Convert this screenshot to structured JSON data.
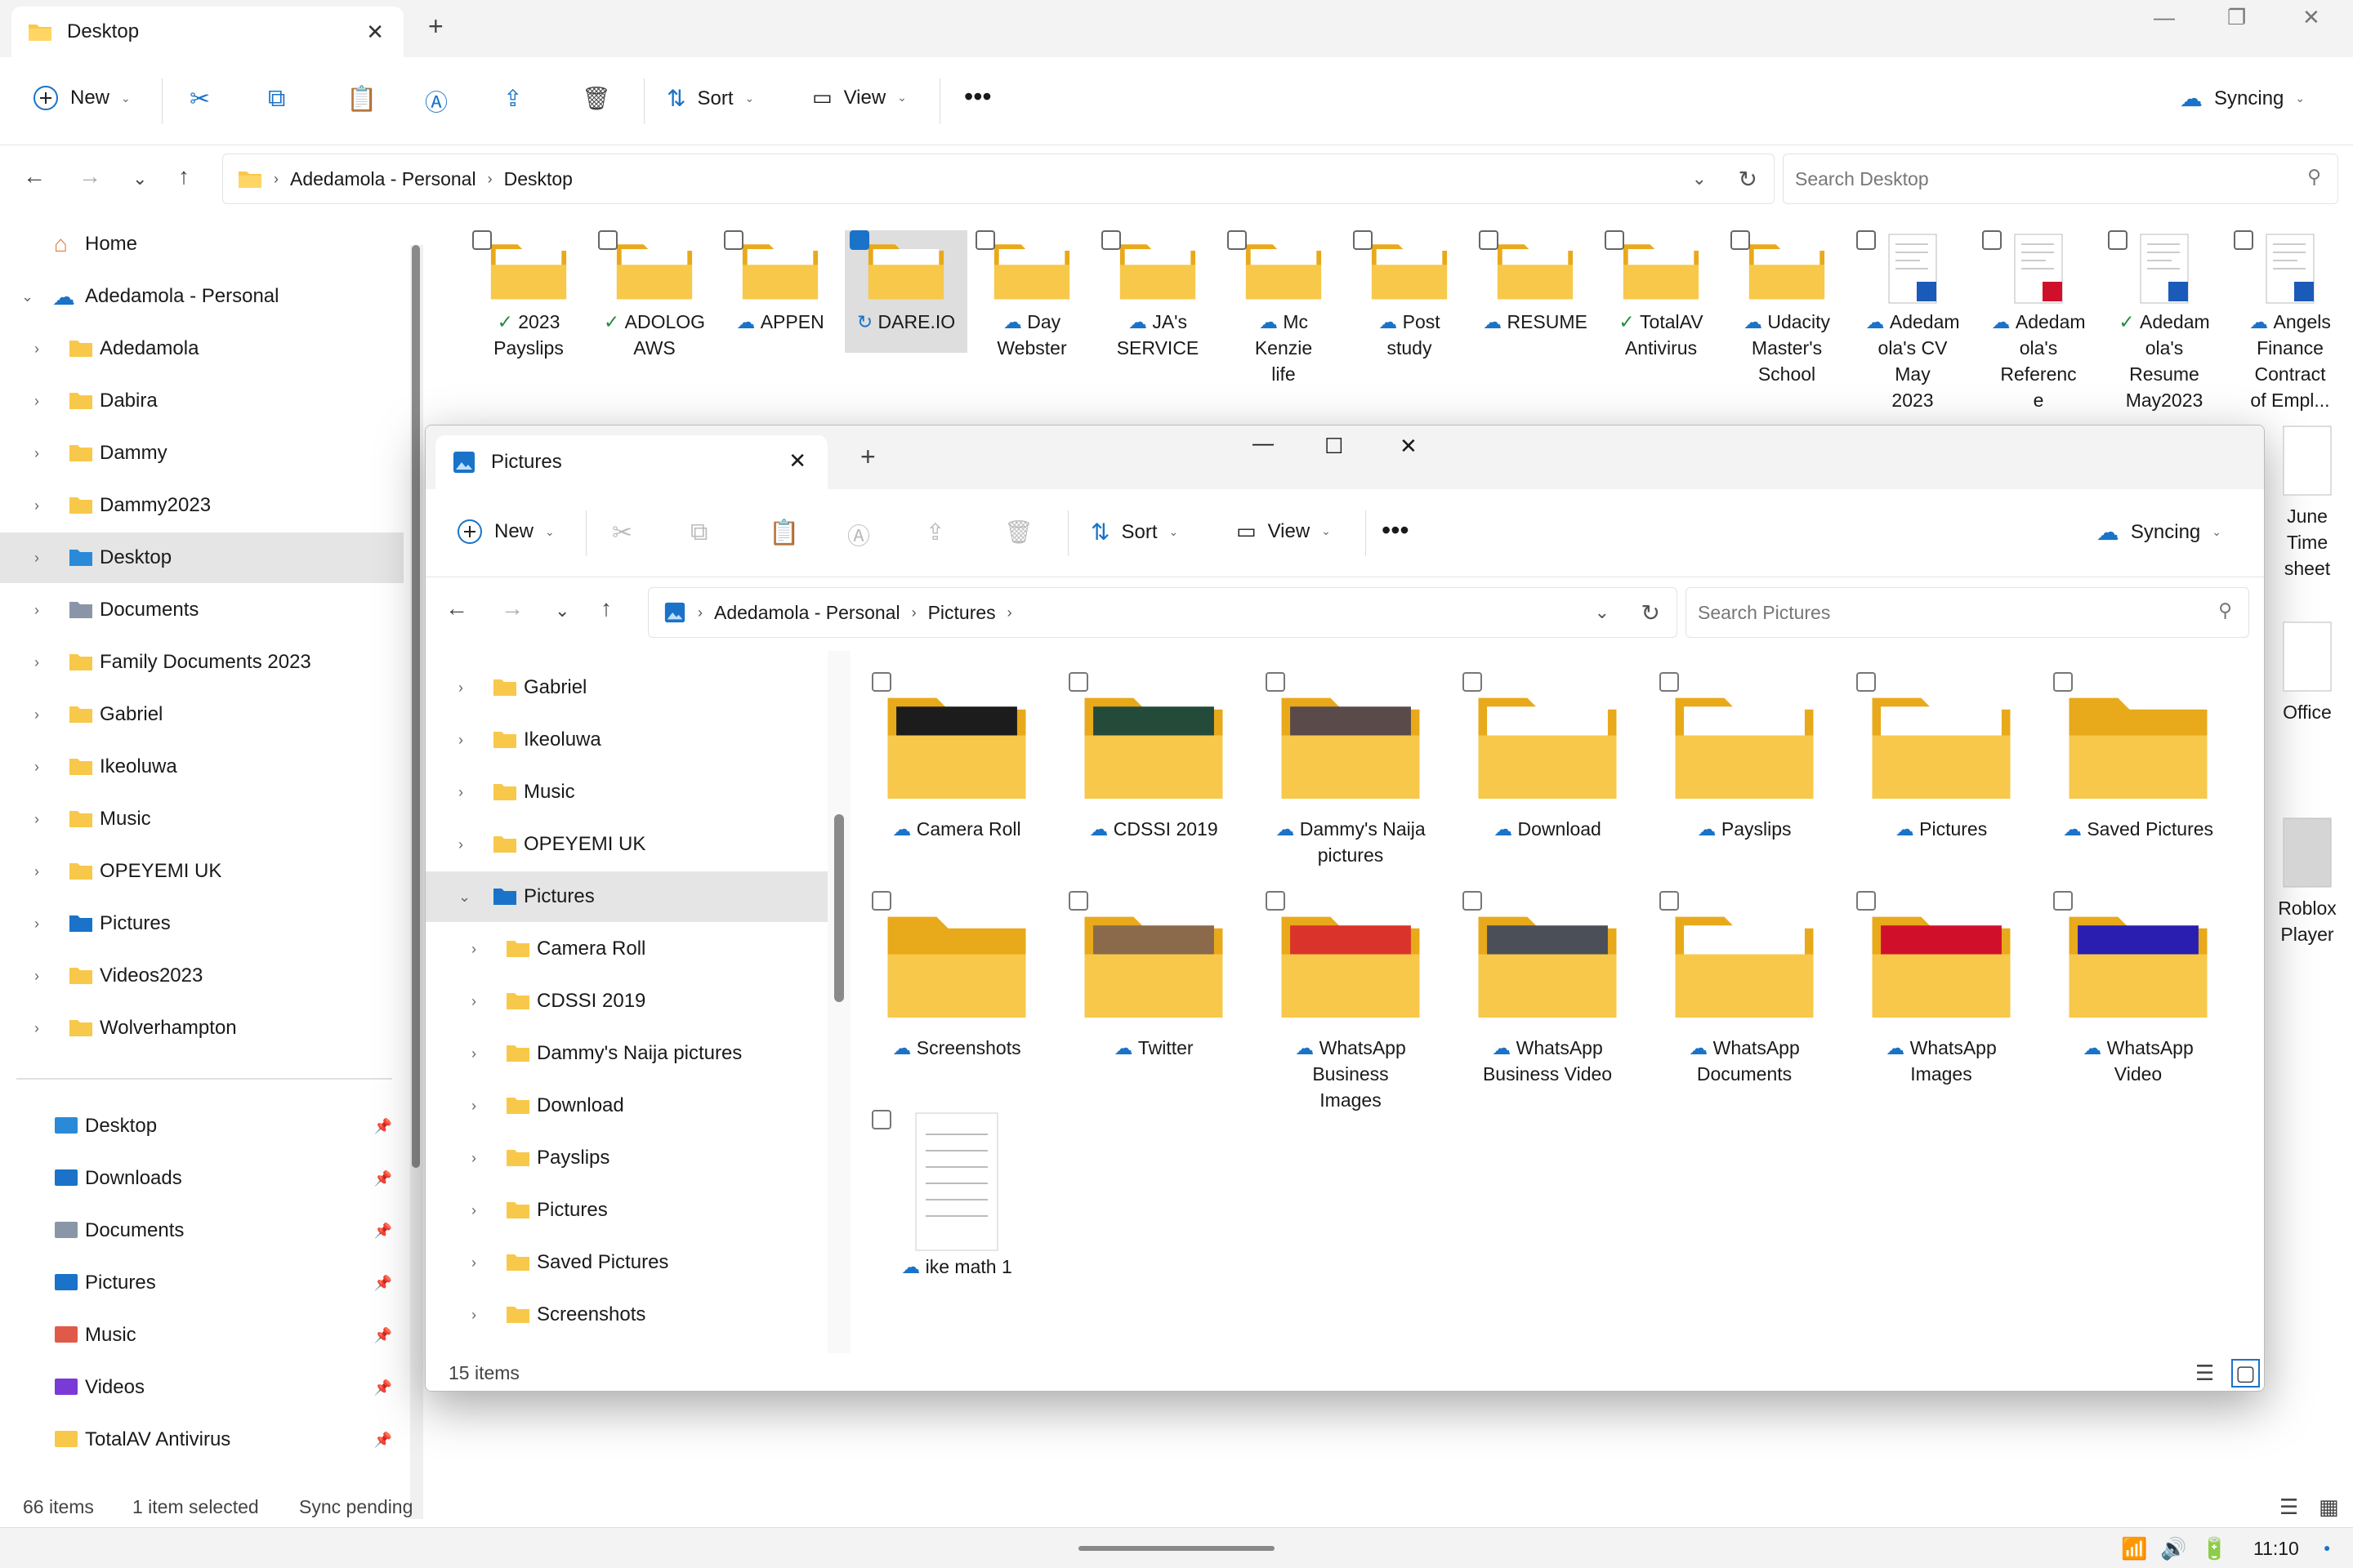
{
  "main": {
    "tab_title": "Desktop",
    "toolbar": {
      "new": "New",
      "sort": "Sort",
      "view": "View",
      "sync": "Syncing"
    },
    "breadcrumb": [
      "Adedamola - Personal",
      "Desktop"
    ],
    "search_placeholder": "Search Desktop",
    "sidebar": {
      "home": "Home",
      "account": "Adedamola - Personal",
      "folders": [
        "Adedamola",
        "Dabira",
        "Dammy",
        "Dammy2023",
        "Desktop",
        "Documents",
        "Family Documents 2023",
        "Gabriel",
        "Ikeoluwa",
        "Music",
        "OPEYEMI UK",
        "Pictures",
        "Videos2023",
        "Wolverhampton"
      ],
      "quick": [
        "Desktop",
        "Downloads",
        "Documents",
        "Pictures",
        "Music",
        "Videos",
        "TotalAV Antivirus"
      ]
    },
    "files": [
      {
        "name": "2023 Payslips",
        "status": "ok"
      },
      {
        "name": "ADOLOG AWS",
        "status": "ok"
      },
      {
        "name": "APPEN",
        "status": "cloud"
      },
      {
        "name": "DARE.IO",
        "status": "sync"
      },
      {
        "name": "Day Webster",
        "status": "cloud"
      },
      {
        "name": "JA's SERVICE",
        "status": "cloud"
      },
      {
        "name": "Mc Kenzie life",
        "status": "cloud"
      },
      {
        "name": "Post study",
        "status": "cloud"
      },
      {
        "name": "RESUME",
        "status": "cloud"
      },
      {
        "name": "TotalAV Antivirus",
        "status": "ok"
      },
      {
        "name": "Udacity Master's School",
        "status": "cloud"
      },
      {
        "name": "Adedamola's CV May 2023",
        "status": "cloud"
      },
      {
        "name": "Adedamola's Reference",
        "status": "cloud"
      },
      {
        "name": "Adedamola's Resume May2023",
        "status": "ok"
      },
      {
        "name": "Angels Finance Contract of Empl...",
        "status": "cloud"
      }
    ],
    "file_labels": [
      [
        "2023",
        "Payslips"
      ],
      [
        "ADOLOG",
        "AWS"
      ],
      [
        "APPEN"
      ],
      [
        "DARE.IO"
      ],
      [
        "Day",
        "Webster"
      ],
      [
        "JA's",
        "SERVICE"
      ],
      [
        "Mc",
        "Kenzie",
        "life"
      ],
      [
        "Post",
        "study"
      ],
      [
        "RESUME"
      ],
      [
        "TotalAV",
        "Antivirus"
      ],
      [
        "Udacity",
        "Master's",
        "School"
      ],
      [
        "Adedam",
        "ola's CV",
        "May",
        "2023"
      ],
      [
        "Adedam",
        "ola's",
        "Referenc",
        "e"
      ],
      [
        "Adedam",
        "ola's",
        "Resume",
        "May2023"
      ],
      [
        "Angels",
        "Finance",
        "Contract",
        "of Empl..."
      ]
    ],
    "right_col": [
      [
        "June",
        "Time",
        "sheet"
      ],
      [
        "Office"
      ],
      [
        "Roblox",
        "Player"
      ]
    ],
    "status": {
      "count": "66 items",
      "selected": "1 item selected",
      "sync": "Sync pending"
    }
  },
  "pictures": {
    "tab_title": "Pictures",
    "toolbar": {
      "new": "New",
      "sort": "Sort",
      "view": "View",
      "sync": "Syncing"
    },
    "breadcrumb": [
      "Adedamola - Personal",
      "Pictures"
    ],
    "search_placeholder": "Search Pictures",
    "sidebar": [
      "Gabriel",
      "Ikeoluwa",
      "Music",
      "OPEYEMI UK",
      "Pictures",
      "Camera Roll",
      "CDSSI 2019",
      "Dammy's Naija pictures",
      "Download",
      "Payslips",
      "Pictures",
      "Saved Pictures",
      "Screenshots"
    ],
    "items": [
      {
        "lines": [
          "Camera Roll"
        ],
        "thumb": "#1c1c1c"
      },
      {
        "lines": [
          "CDSSI 2019"
        ],
        "thumb": "#244a3a"
      },
      {
        "lines": [
          "Dammy's Naija",
          "pictures"
        ],
        "thumb": "#5a4a4a"
      },
      {
        "lines": [
          "Download"
        ],
        "thumb": "#ffffff"
      },
      {
        "lines": [
          "Payslips"
        ],
        "thumb": "#ffffff"
      },
      {
        "lines": [
          "Pictures"
        ],
        "thumb": "#ffffff"
      },
      {
        "lines": [
          "Saved Pictures"
        ],
        "thumb": ""
      },
      {
        "lines": [
          "Screenshots"
        ],
        "thumb": ""
      },
      {
        "lines": [
          "Twitter"
        ],
        "thumb": "#8a6a4a"
      },
      {
        "lines": [
          "WhatsApp",
          "Business",
          "Images"
        ],
        "thumb": "#d9332c"
      },
      {
        "lines": [
          "WhatsApp",
          "Business Video"
        ],
        "thumb": "#4a4f58"
      },
      {
        "lines": [
          "WhatsApp",
          "Documents"
        ],
        "thumb": "#ffffff"
      },
      {
        "lines": [
          "WhatsApp",
          "Images"
        ],
        "thumb": "#d0102a"
      },
      {
        "lines": [
          "WhatsApp",
          "Video"
        ],
        "thumb": "#2a1eb0"
      },
      {
        "lines": [
          "ike math 1"
        ],
        "thumb": "doc"
      }
    ],
    "status": "15 items"
  },
  "taskbar": {
    "time": "11:10"
  },
  "colors": {
    "folder": "#f8c84a",
    "folder_dark": "#e8a91a",
    "accent": "#1a73c8",
    "ok": "#1e8e3e"
  }
}
